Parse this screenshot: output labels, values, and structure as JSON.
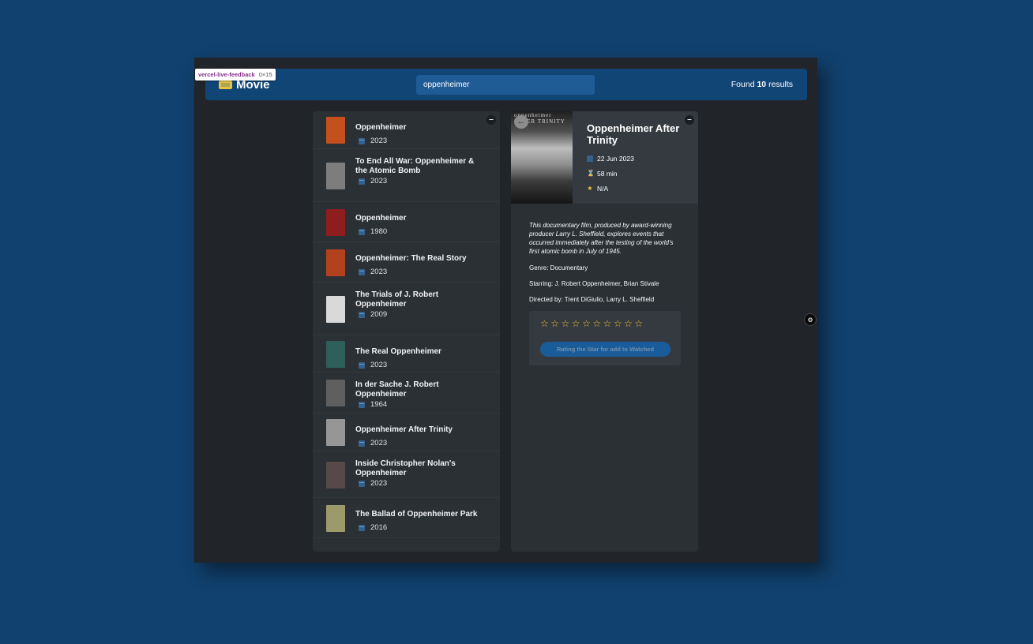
{
  "debug": {
    "name": "vercel-live-feedback",
    "size": "0×15"
  },
  "header": {
    "logo_icon": "popcorn-icon",
    "logo_text": "Movie",
    "search_value": "oppenheimer",
    "results_prefix": "Found ",
    "results_count": "10",
    "results_suffix": " results"
  },
  "list": {
    "toggle": "–",
    "movies": [
      {
        "title": "Oppenheimer",
        "year": "2023",
        "poster_color": "#c4501e"
      },
      {
        "title": "To End All War: Oppenheimer & the Atomic Bomb",
        "year": "2023",
        "poster_color": "#7d7d7d"
      },
      {
        "title": "Oppenheimer",
        "year": "1980",
        "poster_color": "#8e1d1d"
      },
      {
        "title": "Oppenheimer: The Real Story",
        "year": "2023",
        "poster_color": "#b2421e"
      },
      {
        "title": "The Trials of J. Robert Oppenheimer",
        "year": "2009",
        "poster_color": "#d9d9d9"
      },
      {
        "title": "The Real Oppenheimer",
        "year": "2023",
        "poster_color": "#2f5f5a"
      },
      {
        "title": "In der Sache J. Robert Oppenheimer",
        "year": "1964",
        "poster_color": "#5f5f5f"
      },
      {
        "title": "Oppenheimer After Trinity",
        "year": "2023",
        "poster_color": "#969696"
      },
      {
        "title": "Inside Christopher Nolan's Oppenheimer",
        "year": "2023",
        "poster_color": "#59484a"
      },
      {
        "title": "The Ballad of Oppenheimer Park",
        "year": "2016",
        "poster_color": "#9c9a6b"
      }
    ]
  },
  "detail": {
    "toggle": "–",
    "back": "←",
    "poster_text": "oppenheimer AFTER TRINITY",
    "title": "Oppenheimer After Trinity",
    "release": "22 Jun 2023",
    "runtime": "58 min",
    "rating": "N/A",
    "summary": "This documentary film, produced by award-winning producer Larry L. Sheffield, explores events that occurred immediately after the testing of the world's first atomic bomb in July of 1945.",
    "genre": "Genre: Documentary",
    "starring": "Starring: J. Robert Oppenheimer, Brian Stivale",
    "directed": "Directed by: Trent DiGiulio, Larry L. Sheffield",
    "stars_count": 10,
    "star_char": "☆",
    "add_button": "Rating the Star for add to Watched"
  },
  "side_button_icon": "feedback-icon"
}
